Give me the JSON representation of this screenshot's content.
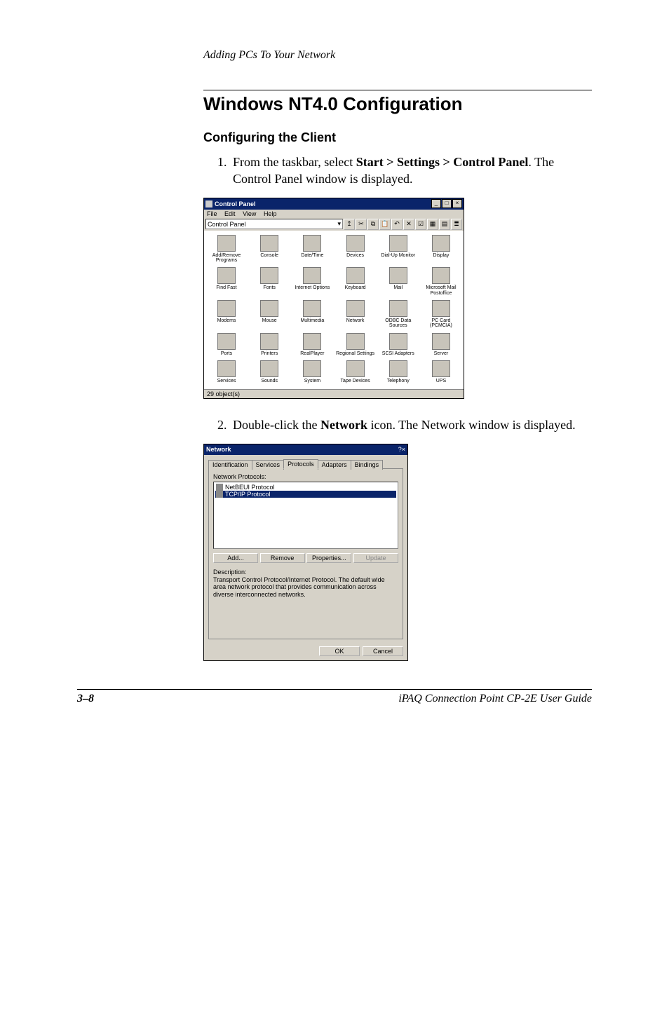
{
  "header": {
    "chapter": "Adding PCs To Your Network"
  },
  "section_title": "Windows NT4.0 Configuration",
  "subsection_title": "Configuring the Client",
  "steps": {
    "s1": {
      "pre": "From the taskbar, select ",
      "bold": "Start > Settings > Control Panel",
      "post": ". The Control Panel window is displayed."
    },
    "s2": {
      "pre": "Double-click the ",
      "bold": "Network",
      "post": " icon. The Network window is displayed."
    }
  },
  "control_panel": {
    "title": "Control Panel",
    "min": "_",
    "max": "□",
    "close": "×",
    "menu": {
      "file": "File",
      "edit": "Edit",
      "view": "View",
      "help": "Help"
    },
    "address": "Control Panel",
    "icons": {
      "r1": [
        "Add/Remove Programs",
        "Console",
        "Date/Time",
        "Devices",
        "Dial-Up Monitor",
        "Display"
      ],
      "r2": [
        "Find Fast",
        "Fonts",
        "Internet Options",
        "Keyboard",
        "Mail",
        "Microsoft Mail Postoffice"
      ],
      "r3": [
        "Modems",
        "Mouse",
        "Multimedia",
        "Network",
        "ODBC Data Sources",
        "PC Card (PCMCIA)"
      ],
      "r4": [
        "Ports",
        "Printers",
        "RealPlayer",
        "Regional Settings",
        "SCSI Adapters",
        "Server"
      ],
      "r5": [
        "Services",
        "Sounds",
        "System",
        "Tape Devices",
        "Telephony",
        "UPS"
      ]
    },
    "status": "29 object(s)"
  },
  "network_dialog": {
    "title": "Network",
    "help": "?",
    "close": "×",
    "tabs": {
      "identification": "Identification",
      "services": "Services",
      "protocols": "Protocols",
      "adapters": "Adapters",
      "bindings": "Bindings"
    },
    "list_label": "Network Protocols:",
    "items": {
      "netbeui": "NetBEUI Protocol",
      "tcpip": "TCP/IP Protocol"
    },
    "buttons": {
      "add": "Add...",
      "remove": "Remove",
      "properties": "Properties...",
      "update": "Update"
    },
    "desc_label": "Description:",
    "desc_text": "Transport Control Protocol/Internet Protocol. The default wide area network protocol that provides communication across diverse interconnected networks.",
    "ok": "OK",
    "cancel": "Cancel"
  },
  "footer": {
    "page": "3–8",
    "guide": "iPAQ Connection Point CP-2E User Guide"
  }
}
